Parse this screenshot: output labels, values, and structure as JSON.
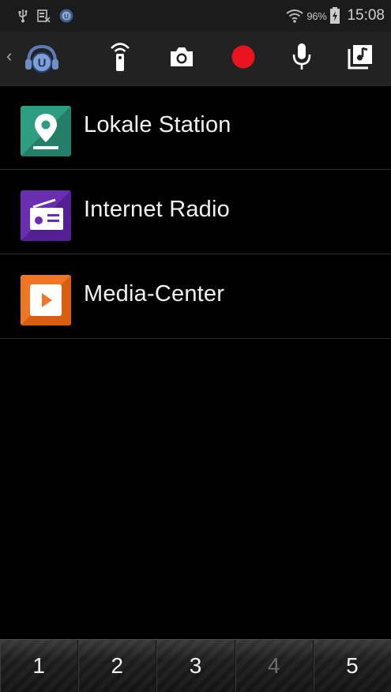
{
  "status_bar": {
    "battery_percent": "96%",
    "time": "15:08",
    "icons": [
      "usb-icon",
      "screenshot-notification-icon",
      "app-notification-icon",
      "wifi-icon",
      "battery-charging-icon"
    ]
  },
  "toolbar": {
    "icons": [
      "back-chevron-icon",
      "app-logo-icon",
      "remote-control-icon",
      "camera-icon",
      "record-icon",
      "microphone-icon",
      "music-library-icon"
    ],
    "app_logo_letter": "U",
    "record_color": "#e8131f"
  },
  "list": {
    "items": [
      {
        "label": "Lokale Station",
        "icon": "location-pin-icon",
        "color": "#2e9e83"
      },
      {
        "label": "Internet Radio",
        "icon": "radio-icon",
        "color": "#6a2fb0"
      },
      {
        "label": "Media-Center",
        "icon": "play-icon",
        "color": "#ef7624"
      }
    ]
  },
  "presets": {
    "buttons": [
      "1",
      "2",
      "3",
      "4",
      "5"
    ]
  }
}
